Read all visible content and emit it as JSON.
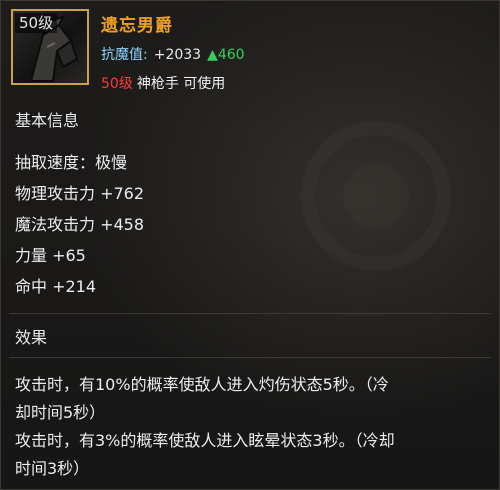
{
  "item": {
    "level_badge": "50级",
    "name": "遗忘男爵",
    "resist_label": "抗魔值:",
    "resist_value": "+2033",
    "resist_bonus": "▲460",
    "required_level": "50级",
    "class_requirement": "神枪手 可使用"
  },
  "colors": {
    "item_name": "#f0a020",
    "resist_label": "#8fd3ff",
    "bonus_green": "#38d05a",
    "required_level_red": "#ff3a3a",
    "icon_border": "#c9a24a"
  },
  "basic_info": {
    "title": "基本信息",
    "stats": [
      "抽取速度：极慢",
      "物理攻击力 +762",
      "魔法攻击力 +458",
      "力量 +65",
      "命中 +214"
    ]
  },
  "effects": {
    "title": "效果",
    "lines": [
      "攻击时，有10%的概率使敌人进入灼伤状态5秒。（冷",
      "却时间5秒）",
      "攻击时，有3%的概率使敌人进入眩晕状态3秒。（冷却",
      "时间3秒）"
    ]
  }
}
